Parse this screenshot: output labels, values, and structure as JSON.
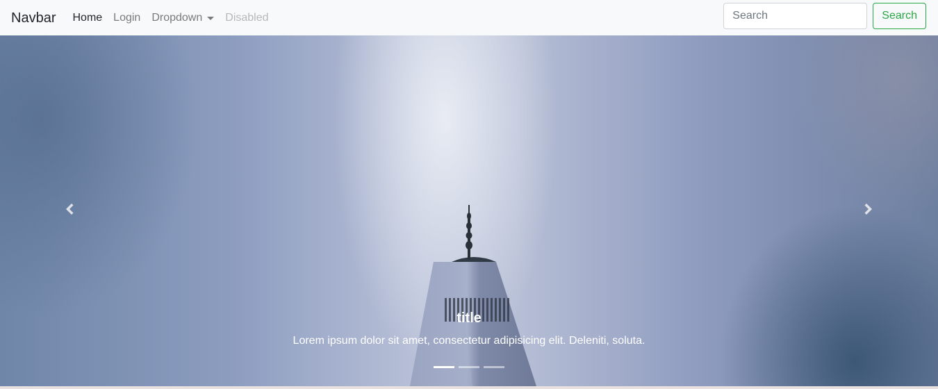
{
  "navbar": {
    "brand": "Navbar",
    "links": [
      {
        "label": "Home",
        "state": "active"
      },
      {
        "label": "Login",
        "state": "normal"
      },
      {
        "label": "Dropdown",
        "state": "normal"
      },
      {
        "label": "Disabled",
        "state": "disabled"
      }
    ],
    "search": {
      "placeholder": "Search",
      "button_label": "Search"
    }
  },
  "carousel": {
    "caption_title": "title",
    "caption_text": "Lorem ipsum dolor sit amet, consectetur adipisicing elit. Deleniti, soluta.",
    "slide_count": 3,
    "active_index": 0,
    "prev_icon": "chevron-left-icon",
    "next_icon": "chevron-right-icon"
  },
  "colors": {
    "navbar_bg": "#f8f9fa",
    "search_button": "#28a745"
  }
}
